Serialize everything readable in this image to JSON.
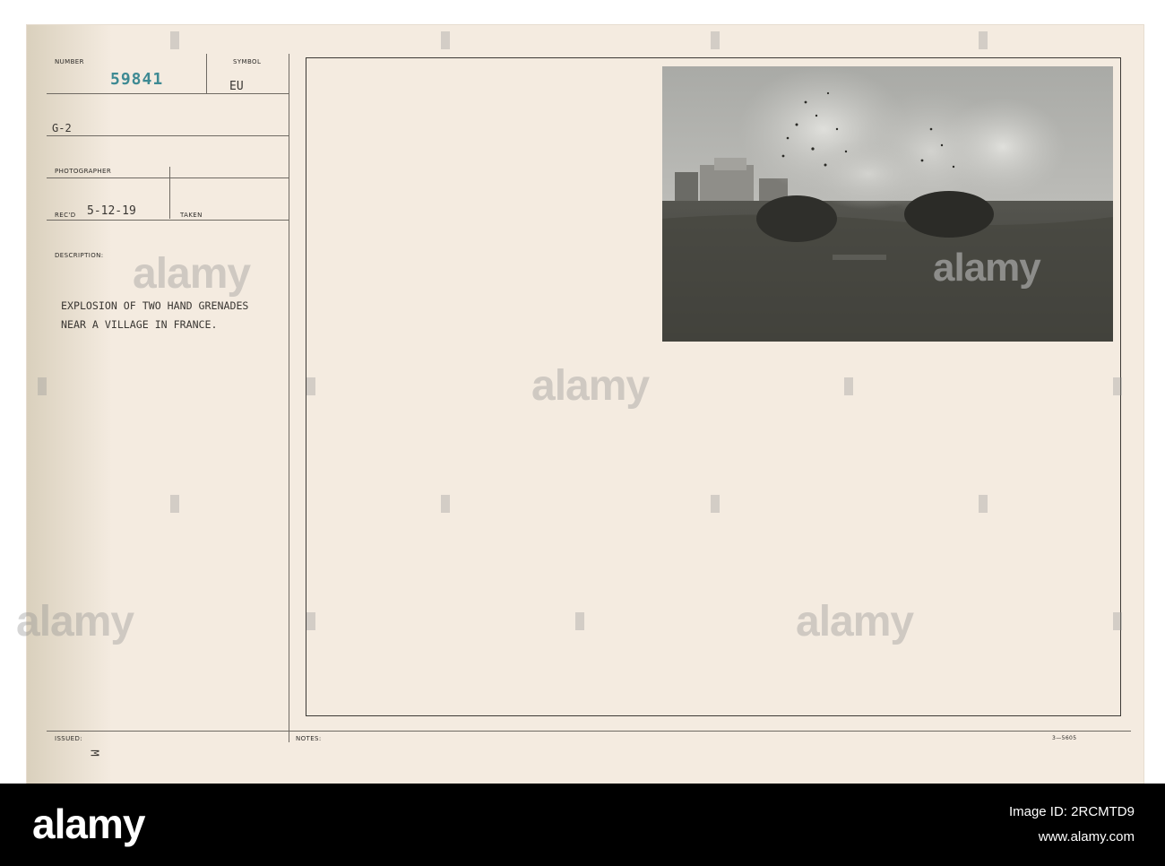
{
  "record": {
    "number_label": "NUMBER",
    "number_value": "59841",
    "symbol_label": "SYMBOL",
    "symbol_value": "EU",
    "code": "G-2",
    "photographer_label": "PHOTOGRAPHER",
    "recd_label": "REC'D",
    "recd_value": "5-12-19",
    "taken_label": "TAKEN",
    "description_label": "DESCRIPTION:",
    "description_lines": [
      "EXPLOSION OF TWO HAND GRENADES",
      "NEAR A VILLAGE IN FRANCE."
    ],
    "issued_label": "ISSUED:",
    "issued_mark": "M",
    "notes_label": "NOTES:",
    "form_code": "3—5605"
  },
  "watermark": "alamy",
  "footer": {
    "logo": "alamy",
    "image_id": "Image ID: 2RCMTD9",
    "site": "www.alamy.com"
  },
  "colors": {
    "paper": "#f4ebe0",
    "stamp": "#3e8a93",
    "ink": "#3a3733",
    "footer_bg": "#000000"
  }
}
